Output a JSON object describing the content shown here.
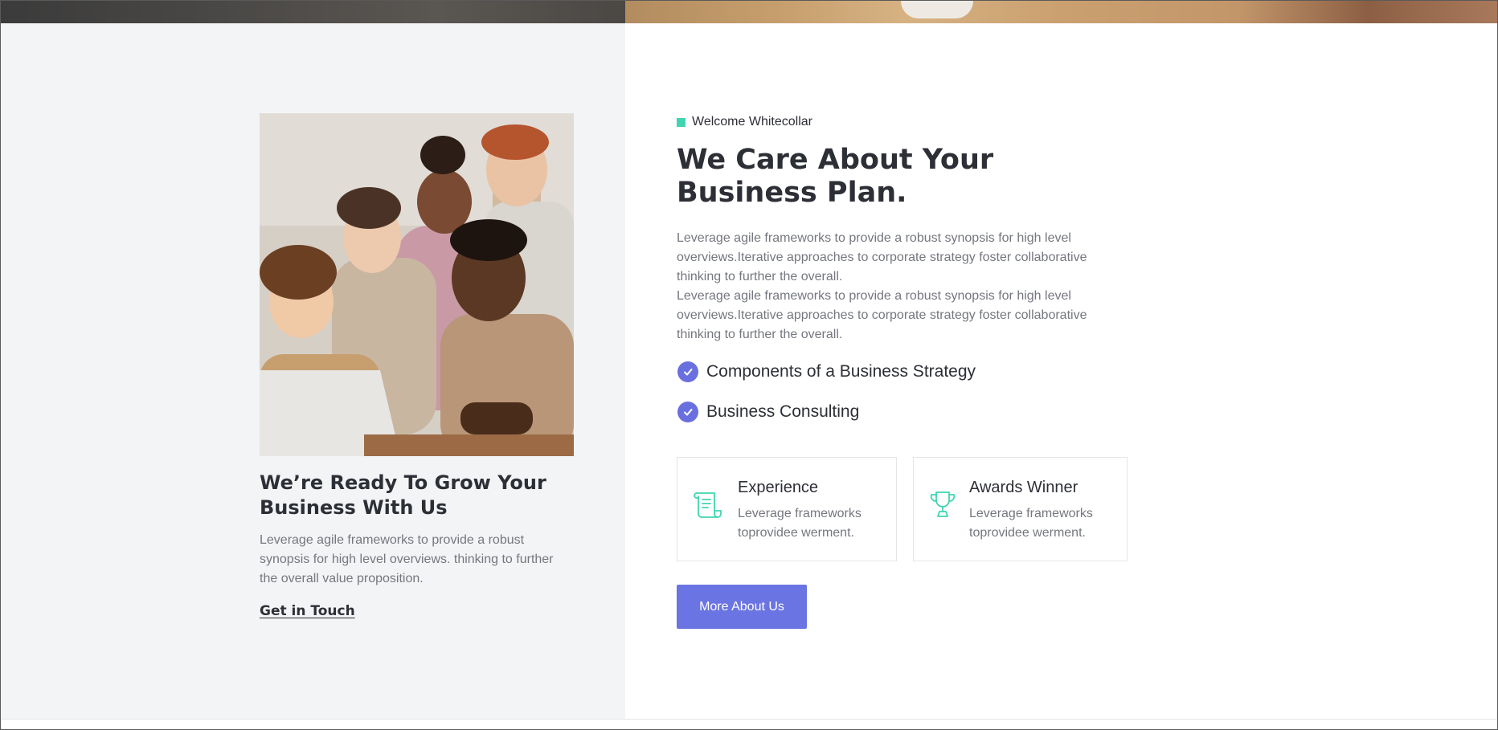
{
  "colors": {
    "accent": "#6a74e2",
    "tag": "#3fd5b0",
    "heading": "#2d2f36",
    "body_text": "#74777e",
    "left_panel_bg": "#f3f4f6"
  },
  "left": {
    "photo_alt": "team-photo",
    "heading": "We’re Ready To Grow Your\nBusiness With Us",
    "text": "Leverage agile frameworks to provide a robust synopsis for high level overviews. thinking to further the overall value proposition.",
    "link_label": "Get in Touch"
  },
  "right": {
    "tag": "Welcome Whitecollar",
    "heading": "We Care About Your\nBusiness Plan.",
    "paragraph_1": "Leverage agile frameworks to provide a robust synopsis for high level overviews.Iterative approaches to corporate strategy foster collaborative thinking to further the overall.",
    "paragraph_2": "Leverage agile frameworks to provide a robust synopsis for high level overviews.Iterative approaches to corporate strategy foster collaborative thinking to further the overall.",
    "checklist": [
      {
        "label": "Components of a Business Strategy",
        "icon": "check-circle-icon"
      },
      {
        "label": "Business Consulting",
        "icon": "check-circle-icon"
      }
    ],
    "cards": [
      {
        "icon": "scroll-icon",
        "title": "Experience",
        "description": "Leverage frameworks toprovidee werment."
      },
      {
        "icon": "trophy-icon",
        "title": "Awards Winner",
        "description": "Leverage frameworks toprovidee werment."
      }
    ],
    "button_label": "More About Us"
  }
}
